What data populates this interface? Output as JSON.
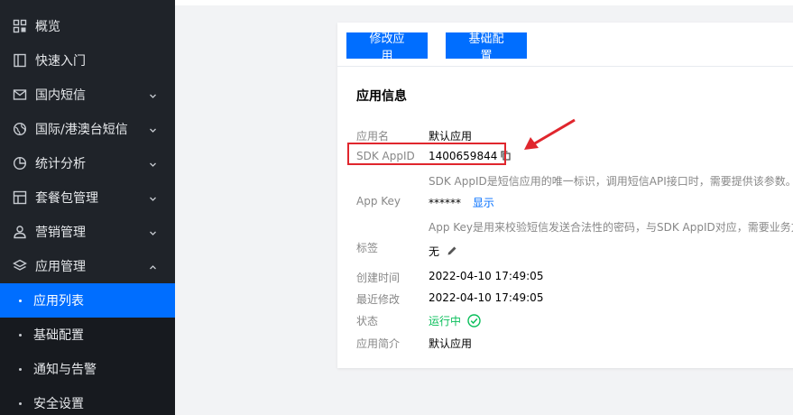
{
  "sidebar": {
    "items": [
      {
        "label": "概览",
        "icon": "grid-icon"
      },
      {
        "label": "快速入门",
        "icon": "book-icon"
      },
      {
        "label": "国内短信",
        "icon": "mail-icon"
      },
      {
        "label": "国际/港澳台短信",
        "icon": "globe-icon"
      },
      {
        "label": "统计分析",
        "icon": "pie-chart-icon"
      },
      {
        "label": "套餐包管理",
        "icon": "package-icon"
      },
      {
        "label": "营销管理",
        "icon": "user-icon"
      },
      {
        "label": "应用管理",
        "icon": "layers-icon"
      }
    ],
    "sub_items": [
      {
        "label": "应用列表"
      },
      {
        "label": "基础配置"
      },
      {
        "label": "通知与告警"
      },
      {
        "label": "安全设置"
      }
    ]
  },
  "toolbar": {
    "edit_label": "修改应用",
    "config_label": "基础配置"
  },
  "app_info": {
    "title": "应用信息",
    "name_label": "应用名",
    "name_value": "默认应用",
    "sdk_label": "SDK AppID",
    "sdk_value": "1400659844",
    "sdk_hint": "SDK AppID是短信应用的唯一标识，调用短信API接口时，需要提供该参数。",
    "key_label": "App Key",
    "key_value": "******",
    "key_show": "显示",
    "key_hint": "App Key是用来校验短信发送合法性的密码，与SDK AppID对应，需要业务方",
    "tag_label": "标签",
    "tag_value": "无",
    "created_label": "创建时间",
    "created_value": "2022-04-10 17:49:05",
    "modified_label": "最近修改",
    "modified_value": "2022-04-10 17:49:05",
    "status_label": "状态",
    "status_value": "运行中",
    "desc_label": "应用简介",
    "desc_value": "默认应用"
  },
  "colors": {
    "accent": "#006eff",
    "sidebar_bg": "#1f2329",
    "status_green": "#0abf5b",
    "highlight_red": "#e0262d"
  }
}
